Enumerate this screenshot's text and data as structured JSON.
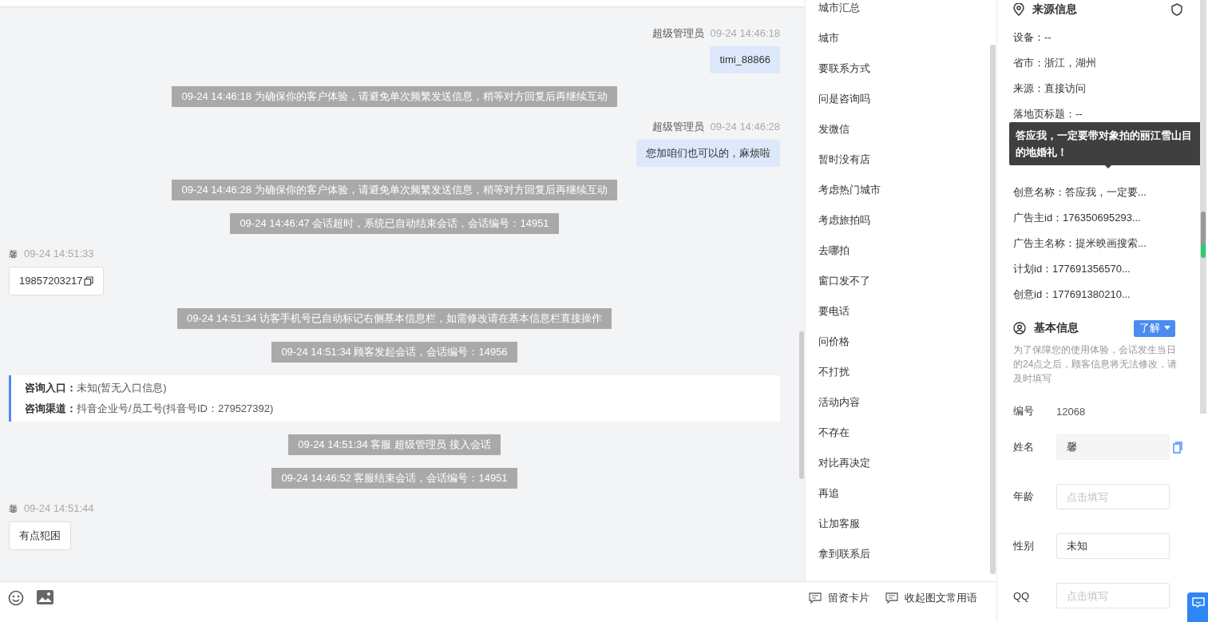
{
  "chat": {
    "messages": [
      {
        "kind": "agent",
        "sender": "超级管理员",
        "time": "09-24 14:46:18",
        "text": "timi_88866"
      },
      {
        "kind": "system",
        "text": "09-24 14:46:18 为确保你的客户体验，请避免单次频繁发送信息，稍等对方回复后再继续互动"
      },
      {
        "kind": "agent",
        "sender": "超级管理员",
        "time": "09-24 14:46:28",
        "text": "您加咱们也可以的，麻烦啦"
      },
      {
        "kind": "system",
        "text": "09-24 14:46:28 为确保你的客户体验，请避免单次频繁发送信息，稍等对方回复后再继续互动"
      },
      {
        "kind": "system",
        "text": "09-24 14:46:47 会话超时，系统已自动结束会话，会话编号：14951"
      },
      {
        "kind": "visitor",
        "avatar": "馨",
        "time": "09-24 14:51:33",
        "text": "19857203217",
        "copyable": true
      },
      {
        "kind": "system",
        "text": "09-24 14:51:34 访客手机号已自动标记右侧基本信息栏，如需修改请在基本信息栏直接操作"
      },
      {
        "kind": "system",
        "text": "09-24 14:51:34 顾客发起会话，会话编号：14956"
      },
      {
        "kind": "info",
        "rows": [
          {
            "label": "咨询入口：",
            "value": "未知(暂无入口信息)"
          },
          {
            "label": "咨询渠道：",
            "value": "抖音企业号/员工号(抖音号ID：279527392)"
          }
        ]
      },
      {
        "kind": "system",
        "text": "09-24 14:51:34 客服 超级管理员 接入会话"
      },
      {
        "kind": "system",
        "text": "09-24 14:46:52 客服结束会话，会话编号：14951"
      },
      {
        "kind": "visitor",
        "avatar": "馨",
        "time": "09-24 14:51:44",
        "text": "有点犯困",
        "copyable": false
      }
    ]
  },
  "quick_replies": [
    "城市汇总",
    "城市",
    "要联系方式",
    "问是咨询吗",
    "发微信",
    "暂时没有店",
    "考虑热门城市",
    "考虑旅拍吗",
    "去哪拍",
    "窗口发不了",
    "要电话",
    "问价格",
    "不打扰",
    "活动内容",
    "不存在",
    "对比再决定",
    "再追",
    "让加客服",
    "拿到联系后"
  ],
  "toolbar": [
    "留资卡片",
    "收起图文常用语"
  ],
  "source_info": {
    "title": "来源信息",
    "rows": [
      "设备：--",
      "省市：浙江，湖州",
      "来源：直接访问",
      "落地页标题：--",
      "创意名称：答应我，一定要...",
      "广告主id：176350695293...",
      "广告主名称：提米映画搜索...",
      "计划id：177691356570...",
      "创意id：177691380210..."
    ],
    "tooltip": "答应我，一定要带对象拍的丽江雪山目的地婚礼！"
  },
  "basic_info": {
    "title": "基本信息",
    "tag": "了解",
    "note": "为了保障您的使用体验，会话发生当日的24点之后，顾客信息将无法修改，请及时填写",
    "fields": [
      {
        "kind": "text",
        "label": "编号",
        "value": "12068"
      },
      {
        "kind": "readonly",
        "label": "姓名",
        "value": "馨"
      },
      {
        "kind": "input",
        "label": "年龄",
        "placeholder": "点击填写"
      },
      {
        "kind": "select",
        "label": "性别",
        "value": "未知"
      },
      {
        "kind": "input",
        "label": "QQ",
        "placeholder": "点击填写"
      }
    ]
  }
}
